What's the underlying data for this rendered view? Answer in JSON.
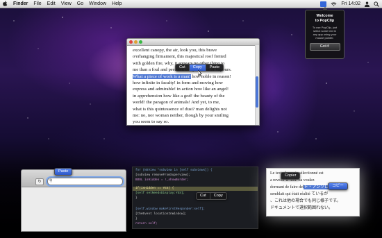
{
  "menubar": {
    "app_name": "Finder",
    "menus": [
      "File",
      "Edit",
      "View",
      "Go",
      "Window",
      "Help"
    ],
    "clock": "Fri 14:02"
  },
  "welcome": {
    "title_line1": "Welcome",
    "title_line2": "to PopClip",
    "body_lines": [
      "To use PopClip, just",
      "select some text in",
      "any app using your",
      "mouse pointer."
    ],
    "button": "Got it!"
  },
  "document": {
    "lines": [
      [
        "excellent canopy, the air, look you, this brave"
      ],
      [
        "o'erhanging firmament, this majestical roof fretted"
      ],
      [
        "with golden fire, why, it appears no other thing to"
      ],
      [
        "me than a foul and pestilent congregation of vapours."
      ],
      [
        "What a piece of work is a man! how noble in reason!"
      ],
      [
        "how infinite in faculty! in form and moving how"
      ],
      [
        "express and admirable! in action how like an angel!"
      ],
      [
        "in apprehension how like a god! the beauty of the"
      ],
      [
        "world! the paragon of animals! And yet, to me,"
      ],
      [
        "what is this quintessence of dust? man delights not"
      ],
      [
        "me: no, nor woman neither, though by your smiling"
      ],
      [
        "you seem to say so."
      ]
    ],
    "selected": "What a piece of work is a man!",
    "after_selected": " how noble in reason!"
  },
  "main_popclip": {
    "cut": "Cut",
    "copy": "Copy",
    "paste": "Paste"
  },
  "safari_popclip": {
    "paste": "Paste"
  },
  "code_popclip": {
    "cut": "Cut",
    "copy": "Copy"
  },
  "french_popclip": {
    "copier": "Copier"
  },
  "japanese_popclip": {
    "copy": "コピー"
  },
  "code": {
    "lines": [
      "for (NSView *subview in [self subviews]) {",
      "  [subview removeFromSuperview];",
      "  BOOL isHidden = !_showBorder;",
      "  if(isHidden == YES) {",
      "    [self setNeedsDisplay:YES];",
      "  }",
      "    [self.window makeFirstResponder:self];",
      "    [theEvent locationInWindow];",
      "  }",
      "  return self;"
    ]
  },
  "japanese": {
    "lines": [
      "Le texte français sélectionné est",
      "a reveler le moi. oa voulez",
      "dormant de faire del",
      "semblait qui était réalité ているが",
      "、これは他の場合でも同じ様子です。",
      "ドキュメントで選択範囲れない。"
    ],
    "selected": "ト・アンソロ"
  },
  "colors": {
    "selection": "#4f78d3",
    "popclip_bg": "#161618",
    "popclip_accent": "#2c57c7"
  }
}
